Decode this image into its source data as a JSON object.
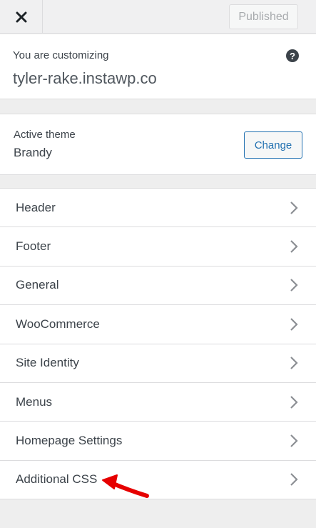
{
  "topbar": {
    "close_icon": "close-icon",
    "publish_label": "Published"
  },
  "info": {
    "customizing_label": "You are customizing",
    "site_name": "tyler-rake.instawp.co",
    "help_icon_glyph": "?"
  },
  "theme": {
    "label": "Active theme",
    "name": "Brandy",
    "change_label": "Change"
  },
  "menu": {
    "items": [
      {
        "label": "Header"
      },
      {
        "label": "Footer"
      },
      {
        "label": "General"
      },
      {
        "label": "WooCommerce"
      },
      {
        "label": "Site Identity"
      },
      {
        "label": "Menus"
      },
      {
        "label": "Homepage Settings"
      },
      {
        "label": "Additional CSS"
      }
    ]
  },
  "colors": {
    "accent": "#2271b1",
    "annotation": "#e60000"
  }
}
